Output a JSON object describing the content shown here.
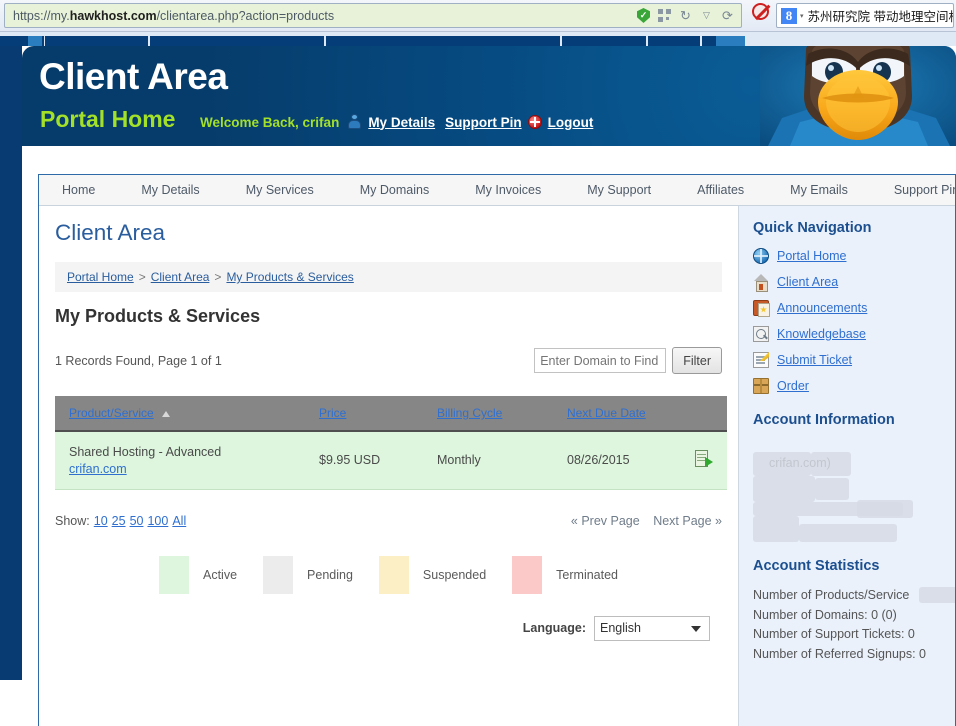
{
  "browser": {
    "url_prefix": "https://my.",
    "url_host": "hawkhost.com",
    "url_path": "/clientarea.php?action=products",
    "shield_glyph": "✓",
    "reload_glyph": "↻",
    "caret_glyph": "▽",
    "reload2_glyph": "⟳",
    "search_text": "苏州研究院 带动地理空间相关产",
    "google_letter": "8",
    "search_caret": "▾"
  },
  "banner": {
    "title": "Client Area",
    "subtitle": "Portal Home",
    "welcome": "Welcome Back, crifan",
    "my_details": "My Details",
    "support_pin": "Support Pin",
    "logout": "Logout"
  },
  "nav_tabs": [
    {
      "label": "Home"
    },
    {
      "label": "My Details"
    },
    {
      "label": "My Services"
    },
    {
      "label": "My Domains"
    },
    {
      "label": "My Invoices"
    },
    {
      "label": "My Support"
    },
    {
      "label": "Affiliates"
    },
    {
      "label": "My Emails"
    },
    {
      "label": "Support Pin"
    }
  ],
  "main": {
    "page_title": "Client Area",
    "breadcrumb": [
      {
        "label": "Portal Home"
      },
      {
        "label": "Client Area"
      },
      {
        "label": "My Products & Services"
      }
    ],
    "breadcrumb_separator": ">",
    "section_title": "My Products & Services",
    "records_text": "1 Records Found, Page 1 of 1",
    "domain_input_placeholder": "Enter Domain to Find",
    "domain_input_value": "",
    "filter_button": "Filter",
    "table": {
      "columns": [
        "Product/Service",
        "Price",
        "Billing Cycle",
        "Next Due Date",
        ""
      ],
      "sort_column": "Product/Service",
      "sort_direction": "asc",
      "rows": [
        {
          "product": "Shared Hosting - Advanced",
          "domain": "crifan.com",
          "price": "$9.95 USD",
          "billing_cycle": "Monthly",
          "next_due_date": "08/26/2015",
          "status": "Active"
        }
      ]
    },
    "show_label": "Show:",
    "show_options": [
      "10",
      "25",
      "50",
      "100",
      "All"
    ],
    "prev_page": "« Prev Page",
    "next_page": "Next Page »",
    "legend": [
      {
        "label": "Active",
        "color": "#ddf6dd"
      },
      {
        "label": "Pending",
        "color": "#ececec"
      },
      {
        "label": "Suspended",
        "color": "#fcefc5"
      },
      {
        "label": "Terminated",
        "color": "#fcc9c9"
      }
    ],
    "language_label": "Language:",
    "language_value": "English",
    "language_options": [
      "English"
    ]
  },
  "sidebar": {
    "quick_nav_heading": "Quick Navigation",
    "quick_nav": [
      {
        "label": "Portal Home",
        "icon": "globe-icon"
      },
      {
        "label": "Client Area",
        "icon": "house-icon"
      },
      {
        "label": "Announcements",
        "icon": "announcement-icon"
      },
      {
        "label": "Knowledgebase",
        "icon": "magnifier-icon"
      },
      {
        "label": "Submit Ticket",
        "icon": "ticket-icon"
      },
      {
        "label": "Order",
        "icon": "package-icon"
      }
    ],
    "account_info_heading": "Account Information",
    "account_info_email_visible": "crifan.com)",
    "account_stats_heading": "Account Statistics",
    "account_stats": [
      {
        "text": "Number of Products/Service",
        "redacted": true
      },
      {
        "text": "Number of Domains: 0 (0)",
        "redacted": false
      },
      {
        "text": "Number of Support Tickets: 0",
        "redacted": false
      },
      {
        "text": "Number of Referred Signups: 0",
        "redacted": false
      }
    ]
  },
  "colors": {
    "banner_blue": "#064a80",
    "accent_green": "#a3e028",
    "link_blue": "#2f6fd0",
    "heading_blue": "#1c4f8f",
    "table_header_gray": "#868686",
    "sidebar_bg": "#eaf1fb"
  }
}
